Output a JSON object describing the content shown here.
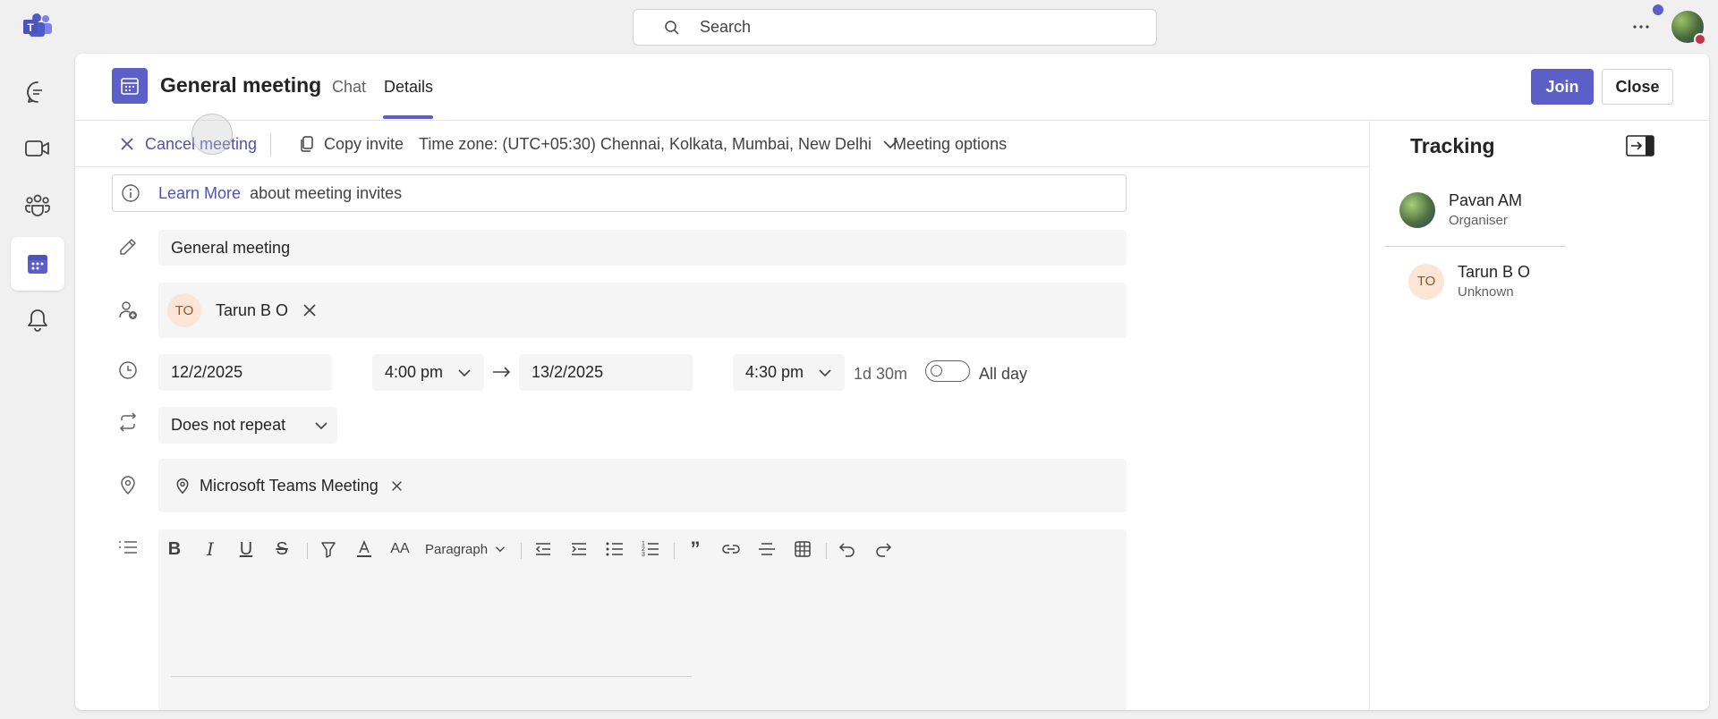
{
  "search": {
    "placeholder": "Search"
  },
  "meeting": {
    "title": "General meeting",
    "tabs": [
      {
        "label": "Chat"
      },
      {
        "label": "Details"
      }
    ],
    "join_label": "Join",
    "close_label": "Close"
  },
  "toolbar": {
    "cancel_label": "Cancel meeting",
    "copy_label": "Copy invite",
    "timezone_label": "Time zone: (UTC+05:30) Chennai, Kolkata, Mumbai, New Delhi",
    "options_label": "Meeting options"
  },
  "info": {
    "link_text": "Learn More",
    "text": "about meeting invites"
  },
  "form": {
    "title_value": "General meeting",
    "attendee": {
      "initials": "TO",
      "name": "Tarun B O"
    },
    "start_date": "12/2/2025",
    "start_time": "4:00 pm",
    "end_date": "13/2/2025",
    "end_time": "4:30 pm",
    "duration": "1d 30m",
    "all_day_label": "All day",
    "all_day_on": false,
    "repeat": "Does not repeat",
    "location": "Microsoft Teams Meeting"
  },
  "editor": {
    "paragraph_label": "Paragraph"
  },
  "tracking": {
    "title": "Tracking",
    "people": [
      {
        "name": "Pavan AM",
        "role": "Organiser"
      },
      {
        "initials": "TO",
        "name": "Tarun B O",
        "role": "Unknown"
      }
    ]
  },
  "colors": {
    "accent": "#5b5fc7",
    "presence_busy": "#c4314b"
  },
  "icons": [
    "teams-logo-icon",
    "search-icon",
    "more-icon",
    "chat-icon",
    "video-icon",
    "teams-icon",
    "calendar-icon",
    "bell-icon",
    "close-icon",
    "copy-icon",
    "chevron-down-icon",
    "info-icon",
    "pencil-icon",
    "person-add-icon",
    "clock-icon",
    "arrow-right-icon",
    "repeat-icon",
    "location-icon",
    "list-icon",
    "collapse-panel-icon"
  ]
}
